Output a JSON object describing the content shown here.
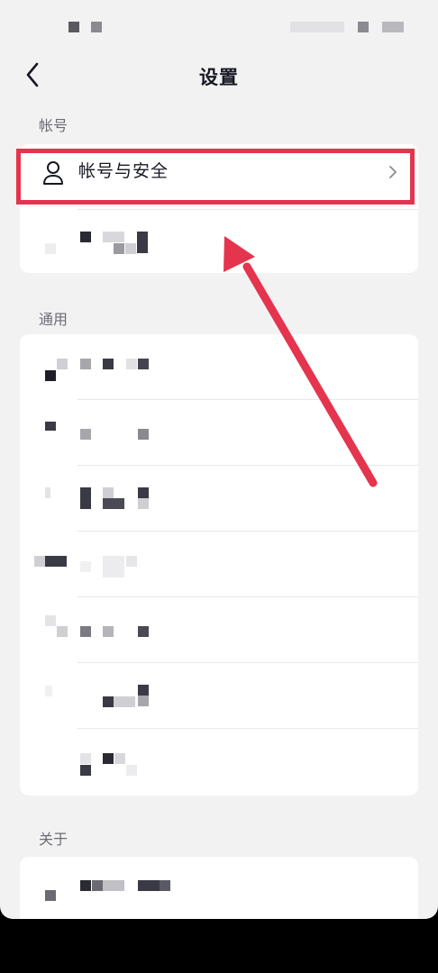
{
  "header": {
    "title": "设置"
  },
  "sections": {
    "account_label": "帐号",
    "general_label": "通用",
    "about_label": "关于"
  },
  "account": {
    "security_label": "帐号与安全"
  },
  "colors": {
    "highlight": "#e5344e",
    "background": "#f2f2f3",
    "card": "#ffffff"
  },
  "icons": {
    "back": "chevron-left-icon",
    "user": "user-icon",
    "forward": "chevron-right-icon"
  }
}
